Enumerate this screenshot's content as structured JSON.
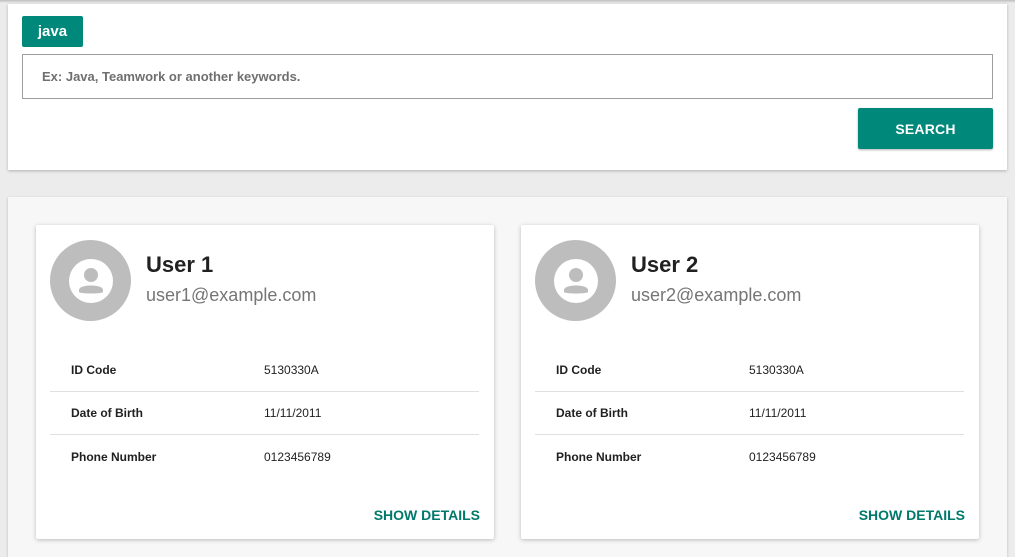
{
  "search": {
    "tag_label": "java",
    "placeholder": "Ex: Java, Teamwork or another keywords.",
    "value": "",
    "button_label": "SEARCH"
  },
  "users": [
    {
      "name": "User 1",
      "email": "user1@example.com",
      "rows": [
        {
          "label": "ID Code",
          "value": "5130330A"
        },
        {
          "label": "Date of Birth",
          "value": "11/11/2011"
        },
        {
          "label": "Phone Number",
          "value": "0123456789"
        }
      ],
      "action_label": "SHOW DETAILS"
    },
    {
      "name": "User 2",
      "email": "user2@example.com",
      "rows": [
        {
          "label": "ID Code",
          "value": "5130330A"
        },
        {
          "label": "Date of Birth",
          "value": "11/11/2011"
        },
        {
          "label": "Phone Number",
          "value": "0123456789"
        }
      ],
      "action_label": "SHOW DETAILS"
    }
  ],
  "colors": {
    "accent": "#00897b",
    "avatar_bg": "#bdbdbd"
  },
  "icons": {
    "avatar": "account-circle-icon"
  }
}
